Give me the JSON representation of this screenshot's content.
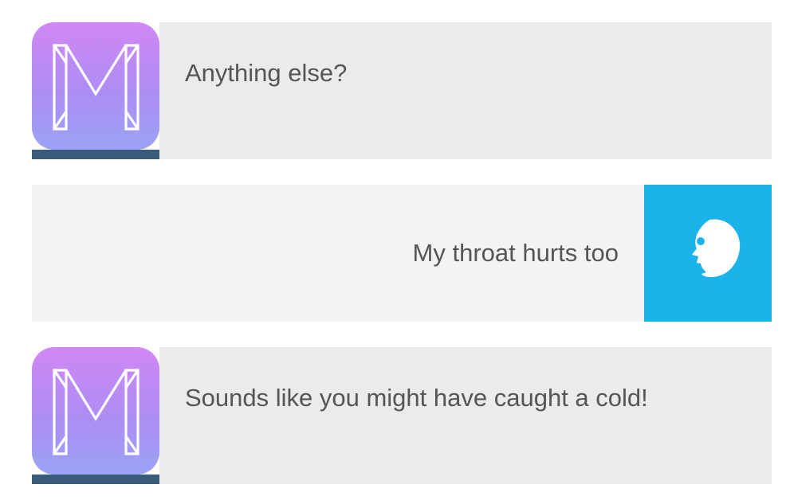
{
  "conversation": {
    "messages": [
      {
        "sender": "bot",
        "text": "Anything else?"
      },
      {
        "sender": "user",
        "text": "My throat hurts too"
      },
      {
        "sender": "bot",
        "text": "Sounds like you might have caught a cold!"
      }
    ]
  },
  "icons": {
    "bot_avatar": "letter-m-logo-icon",
    "user_avatar": "face-profile-icon"
  },
  "colors": {
    "bot_avatar_top": "#d187f4",
    "bot_avatar_bottom": "#9aa3f5",
    "bot_avatar_bar": "#3a5c7c",
    "bot_bubble": "#ebebeb",
    "user_bubble": "#f3f3f3",
    "user_avatar": "#1ab4ea",
    "text": "#555555"
  }
}
